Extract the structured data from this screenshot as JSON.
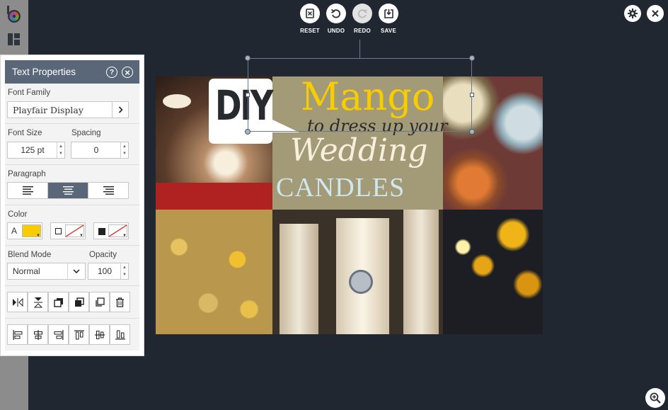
{
  "toolbar": {
    "reset_label": "RESET",
    "undo_label": "UNDO",
    "redo_label": "REDO",
    "save_label": "SAVE"
  },
  "panel": {
    "title": "Text Properties",
    "help_glyph": "?",
    "close_glyph": "×",
    "font_family_label": "Font Family",
    "font_family_value": "Playfair Display",
    "font_size_label": "Font Size",
    "font_size_value": "125 pt",
    "spacing_label": "Spacing",
    "spacing_value": "0",
    "paragraph_label": "Paragraph",
    "paragraph_selected": "center",
    "color_label": "Color",
    "text_color": "#f7cc00",
    "text_color_glyph": "A",
    "blend_mode_label": "Blend Mode",
    "blend_mode_value": "Normal",
    "opacity_label": "Opacity",
    "opacity_value": "100"
  },
  "canvas": {
    "diy_text": "DIY",
    "mango_text": "Mango",
    "tagline_text": "to dress up your",
    "wedding_text": "Wedding",
    "candles_text": "CANDLES",
    "accent_gold": "#f7cc00",
    "accent_cream": "#f6f0dc",
    "accent_blue": "#cfe7ee"
  }
}
